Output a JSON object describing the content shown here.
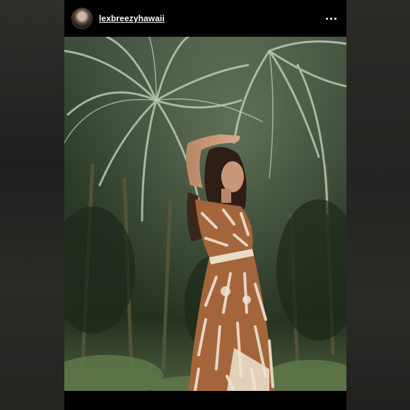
{
  "post": {
    "username": "lexbreezyhawaii",
    "avatar_icon": "profile-avatar",
    "more_icon": "more-options-icon"
  },
  "colors": {
    "background": "#000000",
    "foliage_dark": "#1f2b1e",
    "foliage_light": "#9fb59a",
    "dress_brown": "#a4653a",
    "dress_cream": "#eee3d2"
  }
}
